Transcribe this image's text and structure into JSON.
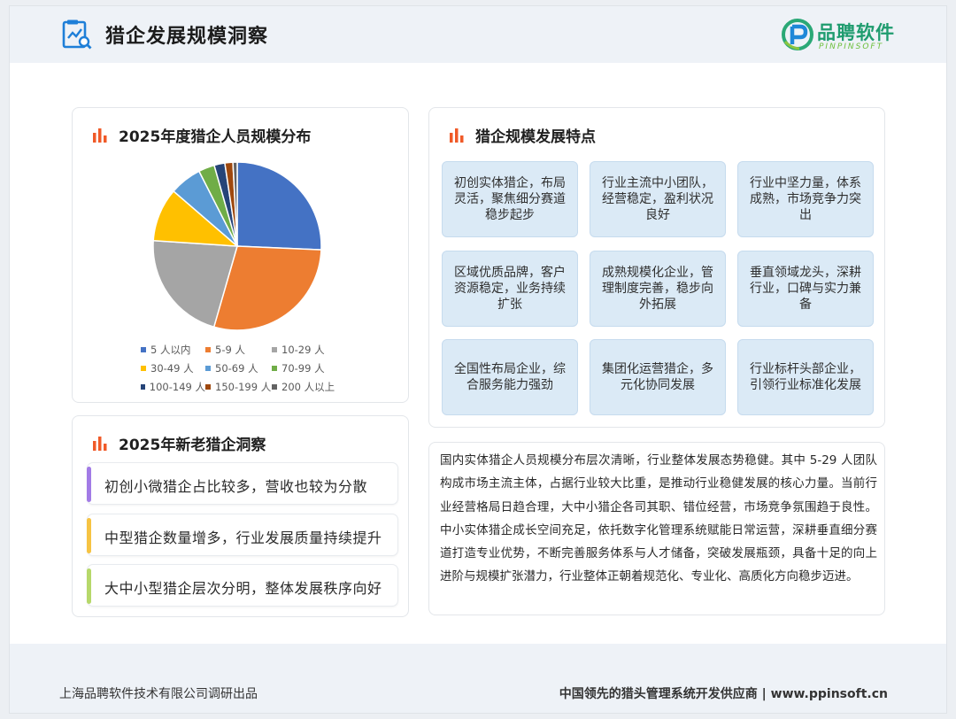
{
  "header": {
    "title": "猎企发展规模洞察",
    "logo_cn": "品聘软件",
    "logo_en": "PINPINSOFT"
  },
  "pie_card": {
    "title": "2025年度猎企人员规模分布"
  },
  "chart_data": {
    "type": "pie",
    "title": "2025年度猎企人员规模分布",
    "legend_position": "bottom",
    "slices": [
      {
        "label": "5 人以内",
        "value": 25,
        "color": "#4472c4"
      },
      {
        "label": "5-9 人",
        "value": 28,
        "color": "#ed7d31"
      },
      {
        "label": "10-29 人",
        "value": 21,
        "color": "#a5a5a5"
      },
      {
        "label": "30-49 人",
        "value": 10,
        "color": "#ffc000"
      },
      {
        "label": "50-69 人",
        "value": 6,
        "color": "#5b9bd5"
      },
      {
        "label": "70-99 人",
        "value": 3,
        "color": "#70ad47"
      },
      {
        "label": "100-149 人",
        "value": 2,
        "color": "#264478"
      },
      {
        "label": "150-199 人",
        "value": 1.5,
        "color": "#9e480e"
      },
      {
        "label": "200 人以上",
        "value": 0.8,
        "color": "#636363"
      }
    ]
  },
  "insight_card": {
    "title": "2025年新老猎企洞察",
    "items": [
      {
        "text": "初创小微猎企占比较多，营收也较为分散",
        "color": "#a27be6"
      },
      {
        "text": "中型猎企数量增多，行业发展质量持续提升",
        "color": "#f6c343"
      },
      {
        "text": "大中小型猎企层次分明，整体发展秩序向好",
        "color": "#b6d86a"
      }
    ]
  },
  "feature_card": {
    "title": "猎企规模发展特点",
    "items": [
      "初创实体猎企，布局灵活，聚焦细分赛道稳步起步",
      "行业主流中小团队，经营稳定，盈利状况良好",
      "行业中坚力量，体系成熟，市场竞争力突出",
      "区域优质品牌，客户资源稳定，业务持续扩张",
      "成熟规模化企业，管理制度完善，稳步向外拓展",
      "垂直领域龙头，深耕行业，口碑与实力兼备",
      "全国性布局企业，综合服务能力强劲",
      "集团化运营猎企，多元化协同发展",
      "行业标杆头部企业，引领行业标准化发展"
    ]
  },
  "summary": {
    "text": "国内实体猎企人员规模分布层次清晰，行业整体发展态势稳健。其中 5-29 人团队构成市场主流主体，占据行业较大比重，是推动行业稳健发展的核心力量。当前行业经营格局日趋合理，大中小猎企各司其职、错位经营，市场竞争氛围趋于良性。中小实体猎企成长空间充足，依托数字化管理系统赋能日常运营，深耕垂直细分赛道打造专业优势，不断完善服务体系与人才储备，突破发展瓶颈，具备十足的向上进阶与规模扩张潜力，行业整体正朝着规范化、专业化、高质化方向稳步迈进。"
  },
  "footer": {
    "left": "上海品聘软件技术有限公司调研出品",
    "right": "中国领先的猎头管理系统开发供应商 | www.ppinsoft.cn"
  },
  "icons": {
    "title_icon": "report-chart-icon",
    "section_icon": "bar-chart-icon",
    "logo_icon": "pinpinsoft-logo-icon"
  }
}
